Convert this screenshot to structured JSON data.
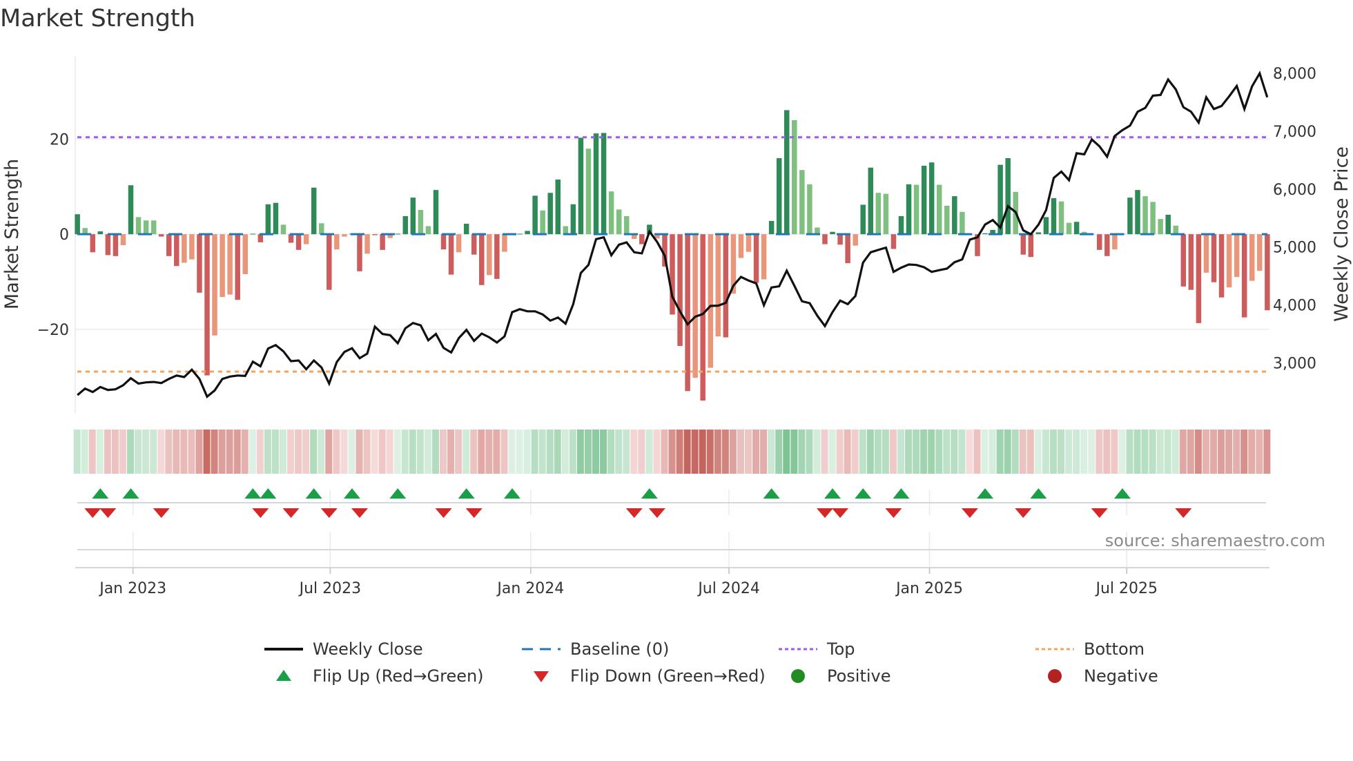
{
  "chart_data": {
    "type": "bar+line",
    "title": "Market Strength",
    "ylabel": "Market Strength",
    "ylabel_right": "Weekly Close Price",
    "source": "source: sharemaestro.com",
    "start_week": "2022-11-11",
    "frequency": "weekly",
    "xlim": [
      "2022-11-09",
      "2025-11-09"
    ],
    "ylim": [
      -37.6,
      37.5
    ],
    "ylim_right": [
      2134,
      8300
    ],
    "top_level": 20.4,
    "bottom_level": -28.9,
    "baseline": 0,
    "x_ticks": [
      {
        "date": "2023-01-01",
        "label": "Jan 2023"
      },
      {
        "date": "2023-07-01",
        "label": "Jul 2023"
      },
      {
        "date": "2024-01-01",
        "label": "Jan 2024"
      },
      {
        "date": "2024-07-01",
        "label": "Jul 2024"
      },
      {
        "date": "2025-01-01",
        "label": "Jan 2025"
      },
      {
        "date": "2025-07-01",
        "label": "Jul 2025"
      }
    ],
    "y_ticks": [
      {
        "value": 20,
        "label": "20"
      },
      {
        "value": 0,
        "label": "0"
      },
      {
        "value": -20,
        "label": "−20"
      }
    ],
    "y_ticks_right": [
      {
        "value": 3000,
        "label": "3,000"
      },
      {
        "value": 4000,
        "label": "4,000"
      },
      {
        "value": 5000,
        "label": "5,000"
      },
      {
        "value": 6000,
        "label": "6,000"
      },
      {
        "value": 7000,
        "label": "7,000"
      },
      {
        "value": 8000,
        "label": "8,000"
      }
    ],
    "strength": [
      4.2,
      1.3,
      -3.8,
      0.6,
      -4.4,
      -4.6,
      -2.3,
      10.3,
      3.6,
      2.9,
      2.9,
      -0.5,
      -4.6,
      -6.7,
      -6.0,
      -5.3,
      -12.3,
      -29.7,
      -21.3,
      -13.2,
      -12.7,
      -13.8,
      -8.4,
      0.1,
      -1.7,
      6.3,
      6.6,
      2.0,
      -1.8,
      -3.3,
      -2.1,
      9.8,
      2.3,
      -11.7,
      -3.2,
      -0.5,
      0.1,
      -7.8,
      -4.1,
      -0.2,
      -3.3,
      -0.8,
      0.1,
      3.8,
      7.7,
      5.1,
      1.7,
      9.3,
      -3.2,
      -8.5,
      -3.8,
      2.2,
      -4.3,
      -10.7,
      -8.6,
      -9.4,
      -3.7,
      0.1,
      0.1,
      0.7,
      8.1,
      5.0,
      8.7,
      11.5,
      1.7,
      6.3,
      20.3,
      18.0,
      21.2,
      21.3,
      9.0,
      5.2,
      3.8,
      -1.0,
      -2.1,
      2.0,
      -0.9,
      -6.8,
      -16.9,
      -23.5,
      -33.0,
      -30.2,
      -35.0,
      -28.1,
      -21.5,
      -21.7,
      -12.5,
      -5.0,
      -3.7,
      -10.2,
      -9.5,
      2.8,
      16.0,
      26.1,
      24.0,
      13.5,
      10.5,
      1.4,
      -2.1,
      0.5,
      -2.2,
      -6.1,
      -2.4,
      6.2,
      14.0,
      8.7,
      8.5,
      -3.1,
      3.8,
      10.5,
      10.4,
      14.4,
      15.1,
      10.4,
      6.0,
      8.0,
      4.7,
      -0.2,
      -4.6,
      0.2,
      0.9,
      14.6,
      16.0,
      8.9,
      -4.3,
      -4.8,
      0.4,
      3.6,
      7.6,
      6.9,
      2.4,
      2.6,
      0.5,
      0.1,
      -3.3,
      -4.6,
      -3.2,
      0.1,
      7.7,
      9.3,
      8.0,
      6.8,
      3.2,
      4.1,
      1.8,
      -11.0,
      -11.7,
      -18.7,
      -8.1,
      -10.1,
      -13.3,
      -11.2,
      -9.0,
      -17.5,
      -9.8,
      -7.7,
      -16.0
    ],
    "strength_tone": "GgRGRRrGgggRRRrrRRrrrRrGRGGgRRrGgRrrGRrRRrGGGggGRRrGRRrRrGGGGgGGgGGgGGgggrRGrRRRRrRrrRrrrRrGGGggggRGRRrGGggRGGgGGggGgRRGGGGgRRGGGggGggRRrGGGgggGgRRRrRRrrRrrR",
    "tone_legend": {
      "G": "positive strengthening",
      "g": "positive weakening",
      "R": "negative weakening",
      "r": "negative recovering"
    },
    "weekly_close": [
      2443,
      2555,
      2495,
      2582,
      2531,
      2543,
      2614,
      2734,
      2642,
      2662,
      2670,
      2650,
      2722,
      2781,
      2754,
      2881,
      2722,
      2415,
      2523,
      2722,
      2762,
      2781,
      2773,
      3020,
      2940,
      3247,
      3306,
      3199,
      3028,
      3040,
      2889,
      3040,
      2920,
      2642,
      3012,
      3187,
      3251,
      3080,
      3159,
      3625,
      3498,
      3477,
      3338,
      3597,
      3688,
      3648,
      3390,
      3498,
      3259,
      3179,
      3426,
      3569,
      3378,
      3505,
      3440,
      3350,
      3457,
      3875,
      3927,
      3890,
      3890,
      3835,
      3728,
      3782,
      3676,
      4014,
      4551,
      4691,
      5136,
      5168,
      4858,
      5041,
      5080,
      4909,
      4890,
      5267,
      5088,
      4850,
      4140,
      3890,
      3664,
      3796,
      3843,
      3983,
      3987,
      4035,
      4333,
      4484,
      4420,
      4372,
      3994,
      4301,
      4321,
      4591,
      4330,
      4062,
      4030,
      3815,
      3636,
      3875,
      4074,
      4014,
      4154,
      4730,
      4909,
      4950,
      4989,
      4571,
      4643,
      4698,
      4690,
      4651,
      4571,
      4600,
      4627,
      4738,
      4786,
      5128,
      5168,
      5387,
      5466,
      5335,
      5705,
      5605,
      5287,
      5220,
      5387,
      5637,
      6194,
      6302,
      6154,
      6620,
      6600,
      6858,
      6739,
      6560,
      6918,
      7018,
      7097,
      7336,
      7403,
      7614,
      7626,
      7893,
      7722,
      7415,
      7336,
      7149,
      7586,
      7383,
      7435,
      7602,
      7781,
      7383,
      7773,
      8000,
      7586
    ],
    "flip_up_weeks": [
      3,
      7,
      23,
      25,
      31,
      36,
      42,
      51,
      57,
      75,
      91,
      99,
      103,
      108,
      119,
      126,
      137
    ],
    "flip_down_weeks": [
      2,
      4,
      11,
      24,
      28,
      33,
      37,
      48,
      52,
      73,
      76,
      98,
      100,
      107,
      117,
      124,
      134,
      145
    ],
    "colors": {
      "bar_G": "#2e8b57",
      "bar_g": "#7fbf7f",
      "bar_R": "#cd5c5c",
      "bar_r": "#e9967a",
      "line": "#111111",
      "baseline": "#1f77b4",
      "top": "#9b5de5",
      "bottom": "#f4a460",
      "flip_up": "#1a9e48",
      "flip_down": "#d62728",
      "positive": "#228b22",
      "negative": "#b22222"
    },
    "legend": [
      {
        "label": "Weekly Close",
        "symbol": "solid-line"
      },
      {
        "label": "Baseline (0)",
        "symbol": "dashed-line"
      },
      {
        "label": "Top",
        "symbol": "dotted-line-purple"
      },
      {
        "label": "Bottom",
        "symbol": "dotted-line-orange"
      },
      {
        "label": "Flip Up (Red→Green)",
        "symbol": "triangle-up"
      },
      {
        "label": "Flip Down (Green→Red)",
        "symbol": "triangle-down"
      },
      {
        "label": "Positive",
        "symbol": "dot-green"
      },
      {
        "label": "Negative",
        "symbol": "dot-red"
      }
    ],
    "legend_position": "bottom"
  }
}
